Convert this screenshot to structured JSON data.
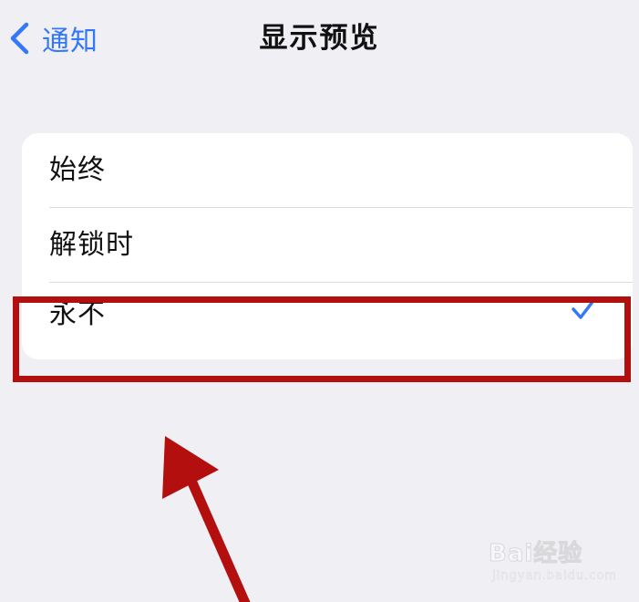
{
  "nav": {
    "back_label": "通知",
    "title": "显示预览"
  },
  "options": [
    {
      "label": "始终",
      "selected": false
    },
    {
      "label": "解锁时",
      "selected": false
    },
    {
      "label": "永不",
      "selected": true
    }
  ],
  "colors": {
    "accent": "#3478f6",
    "background": "#efeff4",
    "annotation": "#b40f0f"
  },
  "annotation": {
    "highlighted_option": "永不",
    "arrow": "pointing-up-left"
  },
  "watermark": {
    "brand": "Bai经验",
    "url": "jingyan.baidu.com"
  }
}
